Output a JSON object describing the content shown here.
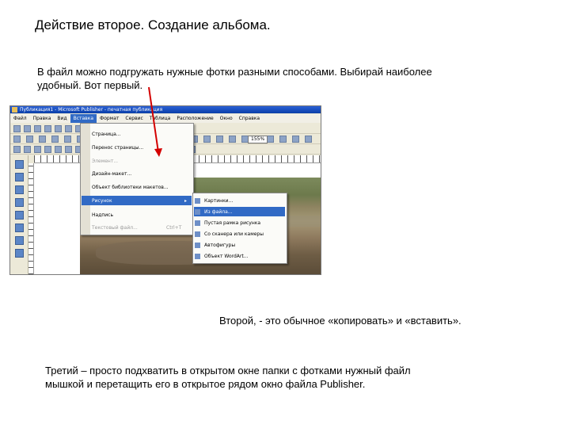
{
  "slide": {
    "title": "Действие второе. Создание альбома.",
    "paragraph1_line1": "В файл можно подгружать нужные фотки разными способами. Выбирай наиболее",
    "paragraph1_line2": "удобный. Вот первый.",
    "paragraph2": "Второй, - это обычное «копировать» и «вставить».",
    "paragraph3_line1": "Третий – просто подхватить в открытом окне папки с фотками нужный файл",
    "paragraph3_line2": "мышкой и перетащить его в открытое рядом окно файла Publisher."
  },
  "publisher": {
    "window_title": "Публикация1 - Microsoft Publisher - печатная публикация",
    "menubar": [
      "Файл",
      "Правка",
      "Вид",
      "Вставка",
      "Формат",
      "Сервис",
      "Таблица",
      "Расположение",
      "Окно",
      "Справка"
    ],
    "active_menu_index": 3,
    "zoom_label": "155%",
    "insert_menu": [
      {
        "label": "Страница...",
        "disabled": false
      },
      {
        "label": "Перенос страницы...",
        "disabled": false
      },
      {
        "label": "Элемент...",
        "disabled": true
      },
      {
        "label": "Дизайн-макет...",
        "disabled": false
      },
      {
        "label": "Объект библиотеки макетов...",
        "disabled": false
      },
      {
        "label": "Рисунок",
        "disabled": false,
        "highlighted": true
      },
      {
        "label": "Надпись",
        "disabled": false
      },
      {
        "label": "Текстовый файл...",
        "disabled": true,
        "shortcut": "Ctrl+T"
      }
    ],
    "picture_submenu": [
      "Картинки...",
      "Из файла...",
      "Пустая рамка рисунка",
      "Со сканера или камеры",
      "Автофигуры",
      "Объект WordArt..."
    ],
    "submenu_highlighted_index": 1
  },
  "colors": {
    "titlebar": "#0a3fa8",
    "highlight": "#316ac5",
    "arrow": "#d40000"
  }
}
